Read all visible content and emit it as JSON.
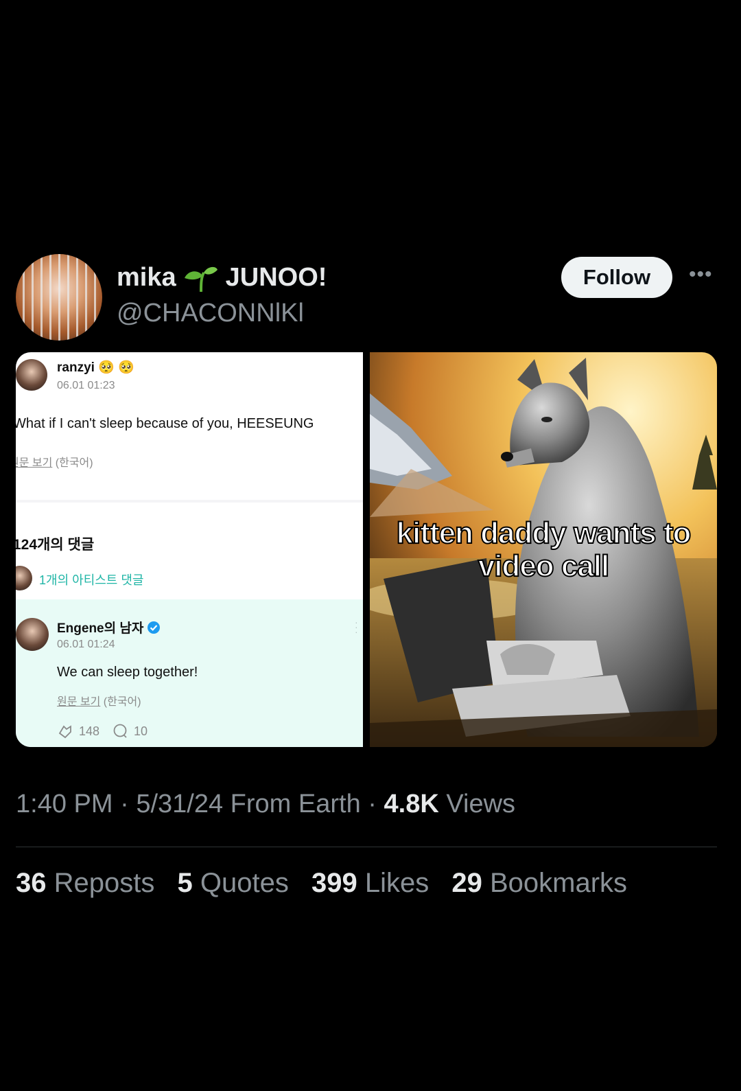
{
  "post": {
    "display_name": "mika",
    "name_suffix": "JUNOO!",
    "name_emoji": "seedling-icon",
    "handle": "@CHACONNlKl",
    "follow_label": "Follow",
    "more_label": "•••"
  },
  "left_card": {
    "user": "ranzyi",
    "user_emoji": "🥺 🥺",
    "date": "06.01 01:23",
    "text": "What if I can't sleep because of you, HEESEUNG",
    "view_original": "원문 보기",
    "language": "(한국어)",
    "comment_count": "124개의 댓글",
    "artist_comments": "1개의 아티스트 댓글",
    "reply_user": "Engene의 남자",
    "reply_date": "06.01 01:24",
    "reply_text": "We can sleep together!",
    "reply_view_original": "원문 보기",
    "reply_language": "(한국어)",
    "likes": "148",
    "comments": "10"
  },
  "right_card": {
    "caption_line1": "kitten daddy wants to",
    "caption_line2": "video call"
  },
  "meta": {
    "time": "1:40 PM",
    "sep1": "·",
    "date": "5/31/24",
    "source": "From Earth",
    "sep2": "·",
    "views_count": "4.8K",
    "views_label": "Views"
  },
  "stats": [
    {
      "count": "36",
      "label": "Reposts"
    },
    {
      "count": "5",
      "label": "Quotes"
    },
    {
      "count": "399",
      "label": "Likes"
    },
    {
      "count": "29",
      "label": "Bookmarks"
    }
  ],
  "colors": {
    "background": "#000000",
    "text": "#e7e9ea",
    "muted": "#8b9298",
    "teal": "#1fb5a6",
    "verified": "#1d9bf0"
  }
}
